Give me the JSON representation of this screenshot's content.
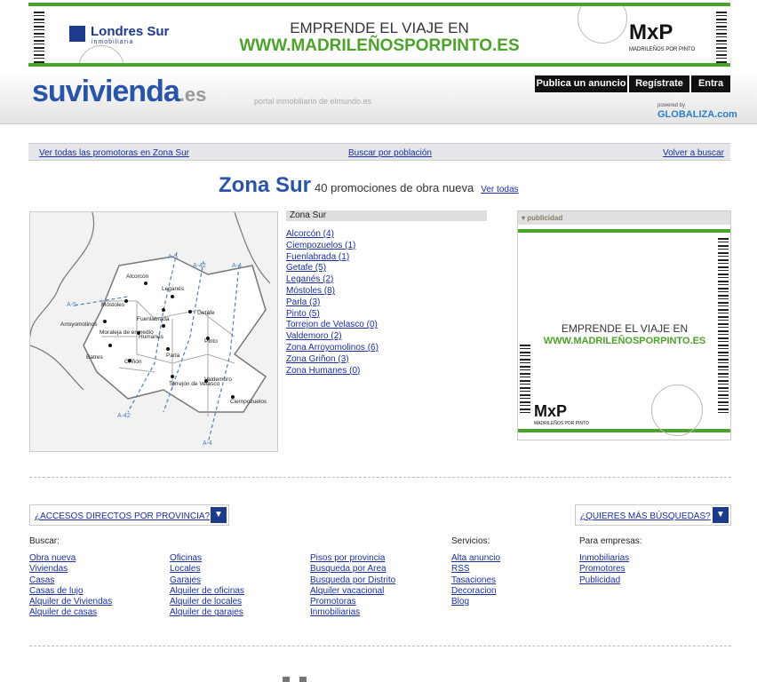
{
  "banner": {
    "brand_left": "Londres Sur",
    "brand_left_sub": "inmobiliaria",
    "line1": "EMPRENDE EL VIAJE EN",
    "line2": "WWW.MADRILEÑOSPORPINTO.ES",
    "brand_right": "MxP",
    "brand_right_sub": "MADRILEÑOS POR PINTO"
  },
  "header": {
    "logo_main": "suvivienda",
    "logo_ext": ".es",
    "tagline": "portal inmobiliario de elmundo.es",
    "nav": [
      "Publica un anuncio",
      "Regístrate",
      "Entra"
    ],
    "powered": "powered by",
    "globaliza": "GLOBALIZA.com"
  },
  "subnav": {
    "promotoras": "Ver todas las promotoras en Zona Sur",
    "poblacion": "Buscar por población",
    "volver": "Volver a buscar"
  },
  "title": {
    "zone": "Zona Sur",
    "count": "40 promociones de obra nueva",
    "ver_todas": "Ver todas"
  },
  "map": {
    "roads": [
      "A-5",
      "A-42",
      "A-4",
      "A-5",
      "A-42",
      "A-4"
    ],
    "towns": [
      "Alcorcón",
      "Leganés",
      "Móstoles",
      "Fuenlabrada",
      "Getafe",
      "Arroyomolinos",
      "Humanes",
      "Moraleja de enmedio",
      "Pinto",
      "Batres",
      "Parla",
      "Griñón",
      "Torrejón de Velasco",
      "Valdemoro",
      "Ciempozuelos"
    ]
  },
  "zones": {
    "heading": "Zona Sur",
    "items": [
      "Alcorcón (4)",
      "Ciempozuelos (1)",
      "Fuenlabrada (1)",
      "Getafe (5)",
      "Leganés (2)",
      "Móstoles (8)",
      "Parla (3)",
      "Pinto (5)",
      "Torrejon de Velasco (0)",
      "Valdemoro (2)",
      "Zona Arroyomolinos (6)",
      "Zona Griñon (3)",
      "Zona Humanes (0)"
    ]
  },
  "publicidad": {
    "label": "publicidad",
    "line1": "EMPRENDE EL VIAJE EN",
    "line2": "WWW.MADRILEÑOSPORPINTO.ES",
    "brand": "MxP",
    "brand_sub": "MADRILEÑOS POR PINTO"
  },
  "dropdowns": {
    "left": "¿ACCESOS DIRECTOS POR PROVINCIA?",
    "right": "¿QUIERES MÁS BÚSQUEDAS?"
  },
  "links": {
    "buscar_label": "Buscar:",
    "col1": [
      "Obra nueva",
      "Viviendas",
      "Casas",
      "Casas de lujo",
      "Alquiler de Viviendas",
      "Alquiler de casas"
    ],
    "col2": [
      "Oficinas",
      "Locales",
      "Garajes",
      "Alquiler de oficinas",
      "Alquiler de locales",
      "Alquiler de garajes"
    ],
    "col3": [
      "Pisos por provincia",
      "Busqueda por Area",
      "Busqueda por Distrito",
      "Alquiler vacacional",
      "Promotoras",
      "Inmobiliarias"
    ],
    "servicios_label": "Servicios:",
    "servicios": [
      "Alta anuncio",
      "RSS",
      "Tasaciones",
      "Decoracion",
      "Blog"
    ],
    "empresas_label": "Para empresas:",
    "empresas": [
      "Inmobiliarias",
      "Promotores",
      "Publicidad"
    ]
  },
  "colors": {
    "green": "#4ba32a",
    "blue": "#2855a8",
    "navy": "#1e3a8a",
    "link": "#1a2fa0"
  }
}
